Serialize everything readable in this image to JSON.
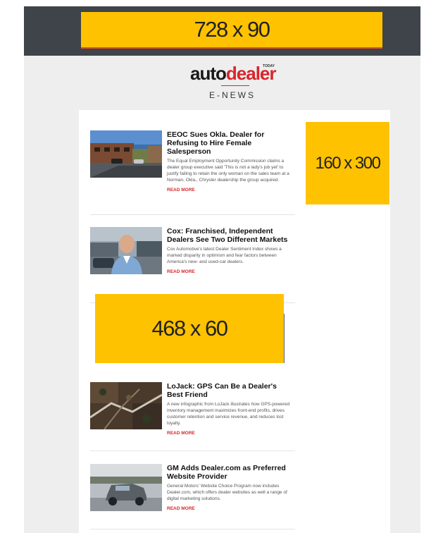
{
  "ads": {
    "leaderboard": "728 x 90",
    "skyscraper": "160 x 300",
    "banner": "468 x 60"
  },
  "logo": {
    "auto": "auto",
    "dealer": "dealer",
    "today": "TODAY"
  },
  "enews": "E-NEWS",
  "articles": [
    {
      "headline": "EEOC Sues Okla. Dealer for Refusing to Hire Female Salesperson",
      "summary": "The Equal Employment Opportunity Commission claims a dealer group executive said 'This is not a lady's job yet' to justify failing to retain the only woman on the sales team at a Norman, Okla., Chrysler dealership the group acquired.",
      "read_more": "READ MORE"
    },
    {
      "headline": "Cox: Franchised, Independent Dealers See Two Different Markets",
      "summary": "Cox Automotive's latest Dealer Sentiment Index shows a marked disparity in optimism and fear factors between America's new- and used-car dealers.",
      "read_more": "READ MORE"
    },
    {
      "headline": "LoJack: GPS Can Be a Dealer's Best Friend",
      "summary": "A new infographic from LoJack illustrates how GPS-powered inventory management maximizes front-end profits, drives customer retention and service revenue, and reduces lost loyalty.",
      "read_more": "READ MORE"
    },
    {
      "headline": "GM Adds Dealer.com as Preferred Website Provider",
      "summary": "General Motors' Website Choice Program now includes Dealer.com, which offers dealer websites as well a range of digital marketing solutions.",
      "read_more": "READ MORE"
    }
  ],
  "colors": {
    "ad_yellow": "#fec200",
    "header_dark": "#3f434a",
    "brand_red": "#d9262c"
  }
}
